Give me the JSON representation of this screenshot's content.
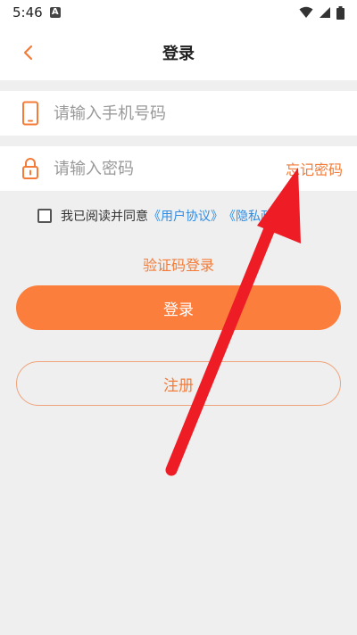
{
  "status_bar": {
    "time": "5:46",
    "notification_badge": "A"
  },
  "header": {
    "title": "登录"
  },
  "phone_field": {
    "placeholder": "请输入手机号码"
  },
  "password_field": {
    "placeholder": "请输入密码",
    "forgot_label": "忘记密码"
  },
  "agreement": {
    "prefix": "我已阅读并同意",
    "user_agreement": "《用户协议》",
    "privacy_policy": "《隐私政策》"
  },
  "sms_login_label": "验证码登录",
  "login_button_label": "登录",
  "register_button_label": "注册",
  "colors": {
    "accent": "#fb7e3c",
    "link": "#2f8de4",
    "arrow": "#ee1c25"
  }
}
